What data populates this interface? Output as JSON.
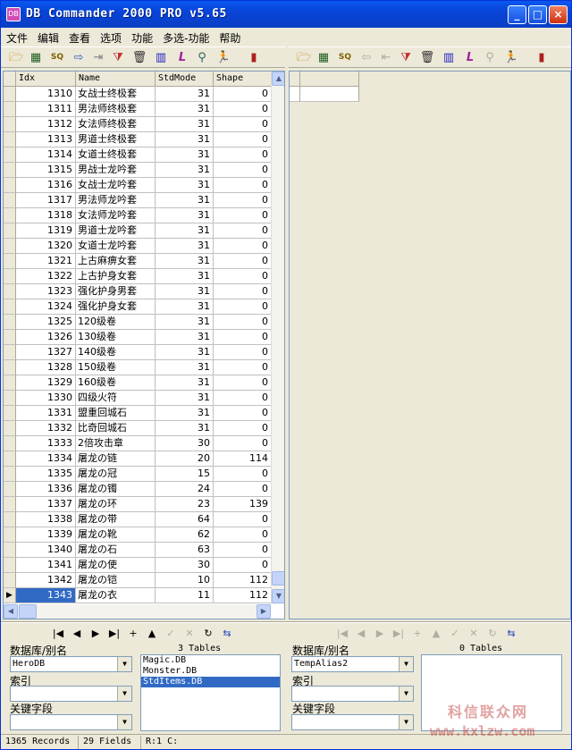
{
  "window": {
    "title": "DB Commander 2000 PRO v5.65",
    "minimize": "_",
    "maximize": "□",
    "close": "×",
    "app_icon": "DB"
  },
  "menu": [
    "文件",
    "编辑",
    "查看",
    "选项",
    "功能",
    "多选-功能",
    "帮助"
  ],
  "left_toolbar_icons": [
    "open-folder-icon",
    "table-icon",
    "sql-icon",
    "arrow-right-icon",
    "export-icon",
    "filter-icon",
    "trash-icon",
    "color-bars-icon",
    "italic-l-icon",
    "search-key-icon",
    "run-icon",
    "exit-door-icon"
  ],
  "right_toolbar_icons": [
    "open-folder-icon",
    "table-icon",
    "sql-icon",
    "arrow-left-icon",
    "import-icon",
    "filter-icon",
    "trash-icon",
    "color-bars-icon",
    "italic-l-icon",
    "search-key-icon",
    "run-icon",
    "exit-door-icon"
  ],
  "grid": {
    "columns": [
      "Idx",
      "Name",
      "StdMode",
      "Shape"
    ],
    "rows": [
      [
        "1310",
        "女战士终极套",
        "31",
        "0"
      ],
      [
        "1311",
        "男法师终极套",
        "31",
        "0"
      ],
      [
        "1312",
        "女法师终极套",
        "31",
        "0"
      ],
      [
        "1313",
        "男道士终极套",
        "31",
        "0"
      ],
      [
        "1314",
        "女道士终极套",
        "31",
        "0"
      ],
      [
        "1315",
        "男战士龙吟套",
        "31",
        "0"
      ],
      [
        "1316",
        "女战士龙吟套",
        "31",
        "0"
      ],
      [
        "1317",
        "男法师龙吟套",
        "31",
        "0"
      ],
      [
        "1318",
        "女法师龙吟套",
        "31",
        "0"
      ],
      [
        "1319",
        "男道士龙吟套",
        "31",
        "0"
      ],
      [
        "1320",
        "女道士龙吟套",
        "31",
        "0"
      ],
      [
        "1321",
        "上古麻痹女套",
        "31",
        "0"
      ],
      [
        "1322",
        "上古护身女套",
        "31",
        "0"
      ],
      [
        "1323",
        "强化护身男套",
        "31",
        "0"
      ],
      [
        "1324",
        "强化护身女套",
        "31",
        "0"
      ],
      [
        "1325",
        "120级卷",
        "31",
        "0"
      ],
      [
        "1326",
        "130级卷",
        "31",
        "0"
      ],
      [
        "1327",
        "140级卷",
        "31",
        "0"
      ],
      [
        "1328",
        "150级卷",
        "31",
        "0"
      ],
      [
        "1329",
        "160级卷",
        "31",
        "0"
      ],
      [
        "1330",
        "四级火符",
        "31",
        "0"
      ],
      [
        "1331",
        "盟重回城石",
        "31",
        "0"
      ],
      [
        "1332",
        "比奇回城石",
        "31",
        "0"
      ],
      [
        "1333",
        "2倍攻击章",
        "30",
        "0"
      ],
      [
        "1334",
        "屠龙の链",
        "20",
        "114"
      ],
      [
        "1335",
        "屠龙の冠",
        "15",
        "0"
      ],
      [
        "1336",
        "屠龙の镯",
        "24",
        "0"
      ],
      [
        "1337",
        "屠龙の环",
        "23",
        "139"
      ],
      [
        "1338",
        "屠龙の带",
        "64",
        "0"
      ],
      [
        "1339",
        "屠龙の靴",
        "62",
        "0"
      ],
      [
        "1340",
        "屠龙の石",
        "63",
        "0"
      ],
      [
        "1341",
        "屠龙の使",
        "30",
        "0"
      ],
      [
        "1342",
        "屠龙の铠",
        "10",
        "112"
      ],
      [
        "1343",
        "屠龙の衣",
        "11",
        "112"
      ]
    ],
    "selected_row_indicator": "▶"
  },
  "nav_left": [
    "|◀",
    "◀",
    "▶",
    "▶|",
    "+",
    "▲",
    "✓",
    "✕",
    "↻",
    "⇆"
  ],
  "nav_right": [
    "|◀",
    "◀",
    "▶",
    "▶|",
    "+",
    "▲",
    "✓",
    "✕",
    "↻",
    "⇆"
  ],
  "left_panel": {
    "db_label": "数据库/别名",
    "db_value": "HeroDB",
    "index_label": "索引",
    "index_value": "",
    "key_label": "关键字段",
    "key_value": "",
    "tables_count": "3 Tables",
    "tables": [
      "Magic.DB",
      "Monster.DB",
      "StdItems.DB"
    ],
    "selected_table": 2
  },
  "right_panel": {
    "db_label": "数据库/别名",
    "db_value": "TempAlias2",
    "index_label": "索引",
    "index_value": "",
    "key_label": "关键字段",
    "key_value": "",
    "tables_count": "0 Tables"
  },
  "status": {
    "records": "1365 Records",
    "fields": "29 Fields",
    "rc": "R:1 C:"
  },
  "watermark": {
    "line1": "科信联众网",
    "line2": "www.kxlzw.com"
  },
  "colors": {
    "title_blue": "#0a4fe6",
    "selection": "#316ac5",
    "face": "#ece9d8"
  }
}
